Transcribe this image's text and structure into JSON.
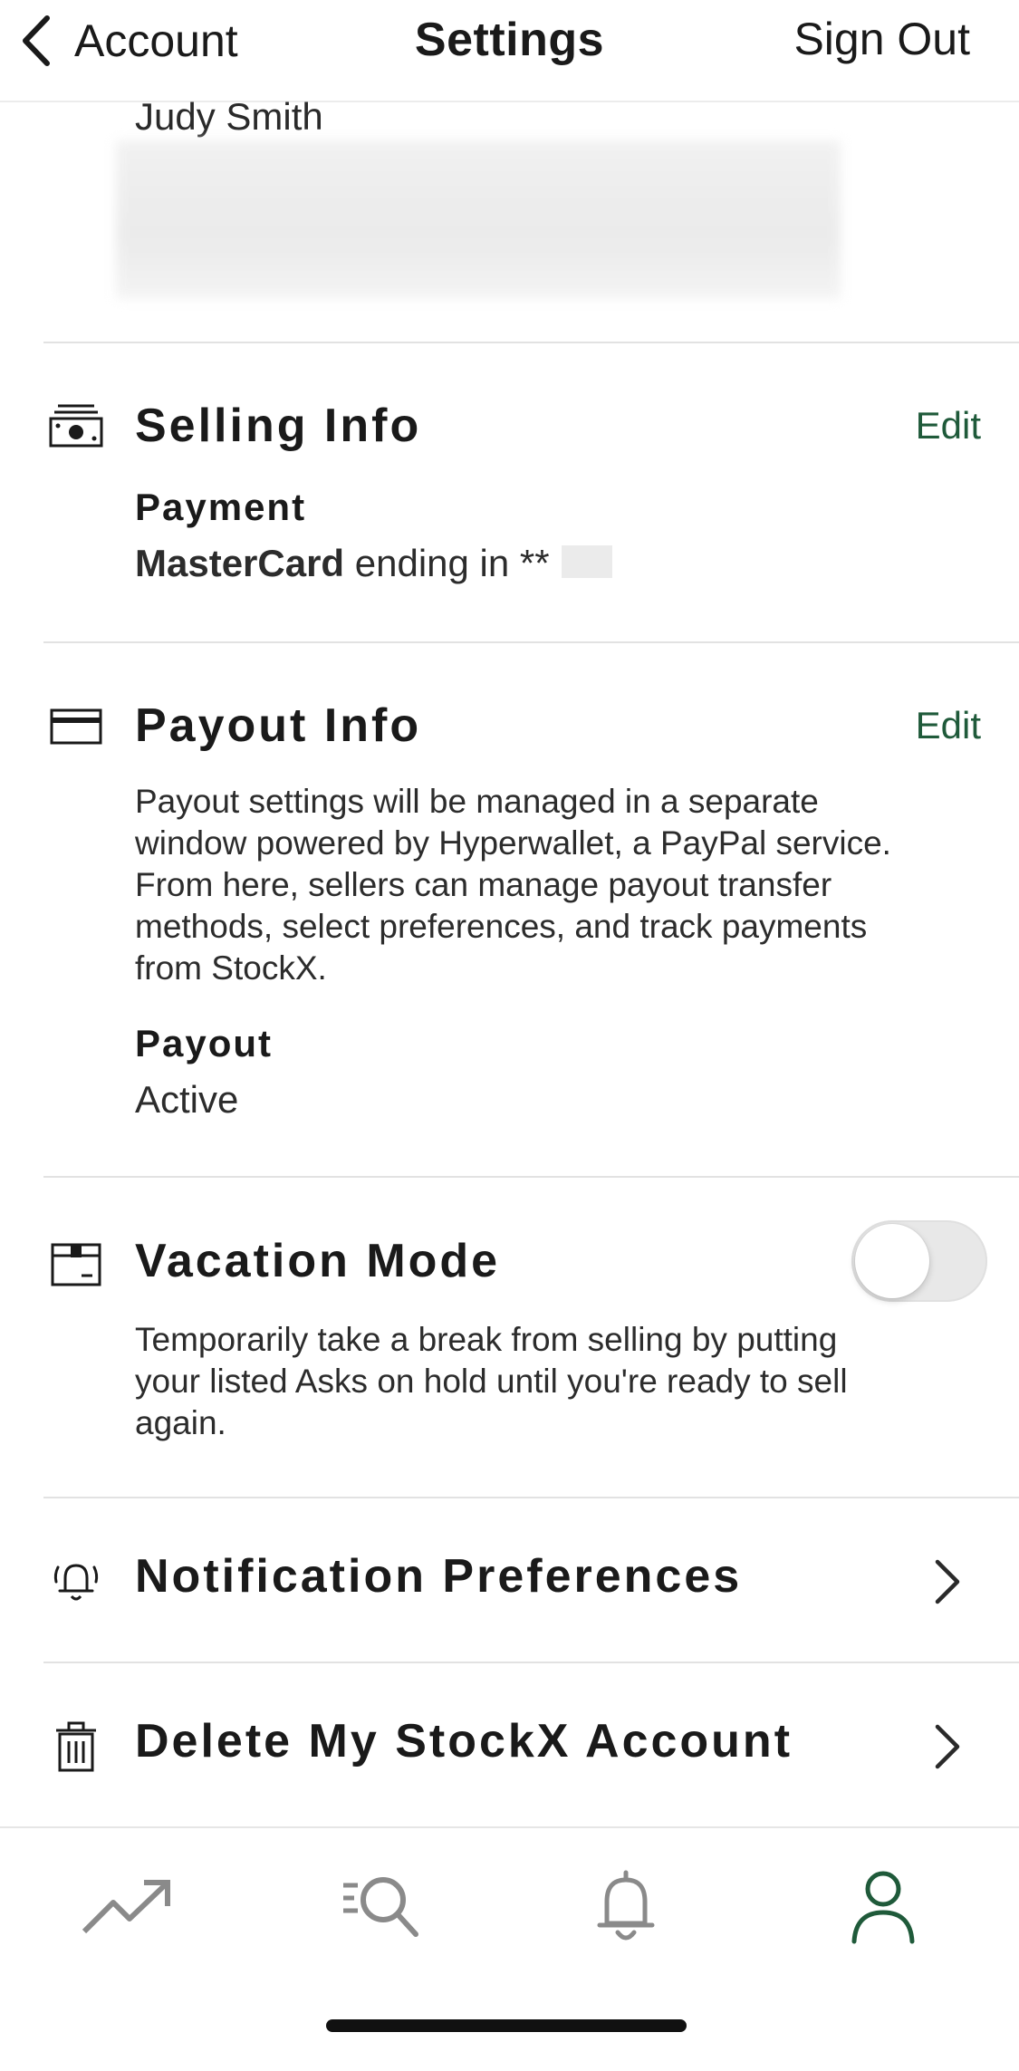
{
  "nav": {
    "back_label": "Account",
    "title": "Settings",
    "signout_label": "Sign Out"
  },
  "profile": {
    "name": "Judy Smith"
  },
  "selling_info": {
    "title": "Selling Info",
    "edit_label": "Edit",
    "payment_label": "Payment",
    "card_brand": "MasterCard",
    "card_suffix_text": " ending in **"
  },
  "payout_info": {
    "title": "Payout Info",
    "edit_label": "Edit",
    "description_lines": [
      "Payout settings will be managed in a separate",
      "window powered by Hyperwallet, a PayPal service.",
      "From here, sellers can manage payout transfer",
      "methods, select preferences, and track payments",
      "from StockX."
    ],
    "payout_label": "Payout",
    "payout_status": "Active"
  },
  "vacation_mode": {
    "title": "Vacation Mode",
    "enabled": false,
    "description_lines": [
      "Temporarily take a break from selling by putting",
      "your listed Asks on hold until you're ready to sell",
      "again."
    ]
  },
  "rows": [
    {
      "label": "Notification Preferences",
      "icon": "bell-alert-icon"
    },
    {
      "label": "Delete My StockX Account",
      "icon": "trash-icon"
    }
  ],
  "tabbar": {
    "items": [
      {
        "icon": "trending-icon",
        "active": false
      },
      {
        "icon": "search-icon",
        "active": false
      },
      {
        "icon": "bell-icon",
        "active": false
      },
      {
        "icon": "profile-icon",
        "active": true
      }
    ]
  },
  "colors": {
    "accent": "#1f5a3a",
    "text": "#1a1a1a",
    "inactive_icon": "#8a8a8a",
    "divider": "#e2e2e2"
  }
}
